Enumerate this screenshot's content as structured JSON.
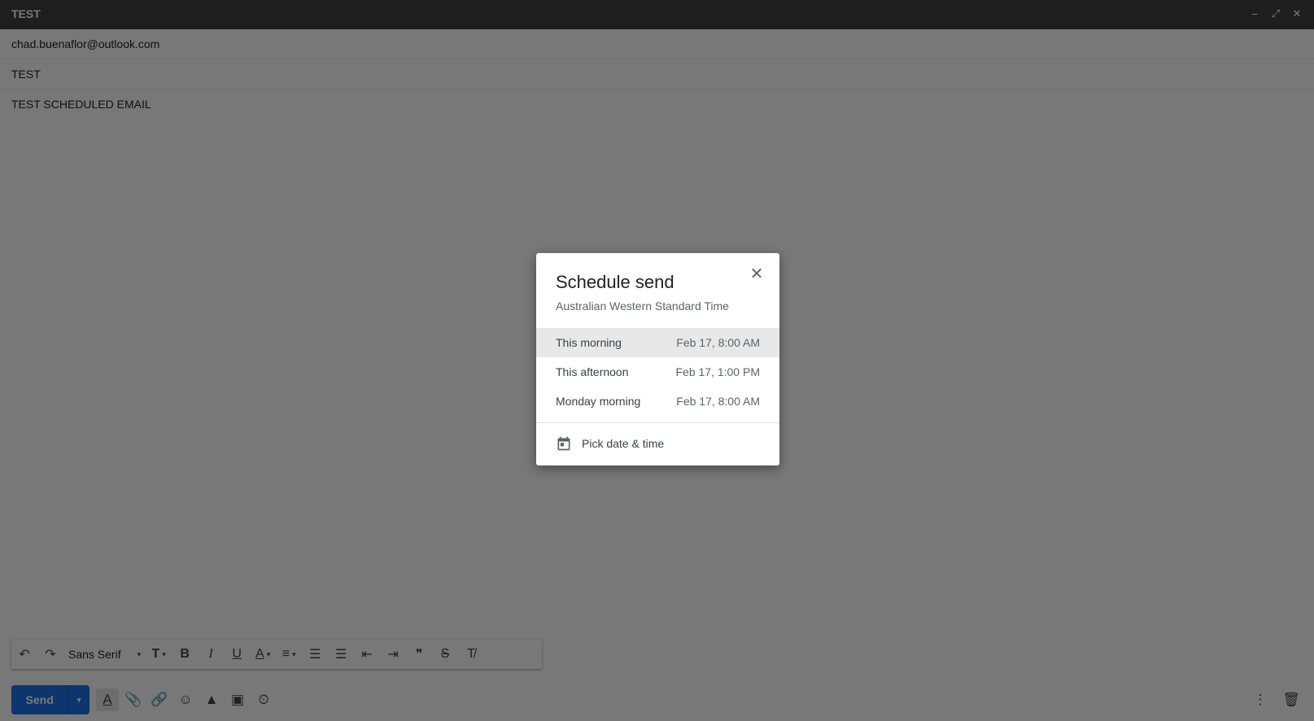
{
  "window": {
    "title": "TEST",
    "controls": [
      {
        "name": "minimize-icon",
        "glyph": "–"
      },
      {
        "name": "expand-icon",
        "glyph": "⤢"
      },
      {
        "name": "close-icon",
        "glyph": "✕"
      }
    ]
  },
  "compose": {
    "to": "chad.buenaflor@outlook.com",
    "subject": "TEST",
    "body": "TEST SCHEDULED EMAIL"
  },
  "format_toolbar": {
    "undo": "↶",
    "redo": "↷",
    "font": "Sans Serif",
    "caret": "▾",
    "size": "ᴛ T",
    "bold": "B",
    "italic": "I",
    "underline": "U",
    "text_color": "A",
    "align": "≡",
    "numbered_list": "☰",
    "bulleted_list": "☰",
    "indent_less": "⇤",
    "indent_more": "⇥",
    "quote": "❞",
    "strikethrough": "S",
    "remove_format": "T̸"
  },
  "bottom_bar": {
    "send_label": "Send",
    "send_caret": "▾",
    "icons": {
      "formatting": "A",
      "attach": "📎",
      "link": "🔗",
      "emoji": "☺",
      "drive": "▲",
      "photo": "▣",
      "confidential": "⏲",
      "more": "⋮",
      "trash": "🗑"
    }
  },
  "dialog": {
    "title": "Schedule send",
    "close": "✕",
    "timezone": "Australian Western Standard Time",
    "options": [
      {
        "label": "This morning",
        "when": "Feb 17, 8:00 AM"
      },
      {
        "label": "This afternoon",
        "when": "Feb 17, 1:00 PM"
      },
      {
        "label": "Monday morning",
        "when": "Feb 17, 8:00 AM"
      }
    ],
    "pick_label": "Pick date & time"
  },
  "colors": {
    "send_button": "#1a73e8",
    "titlebar": "#404040"
  }
}
